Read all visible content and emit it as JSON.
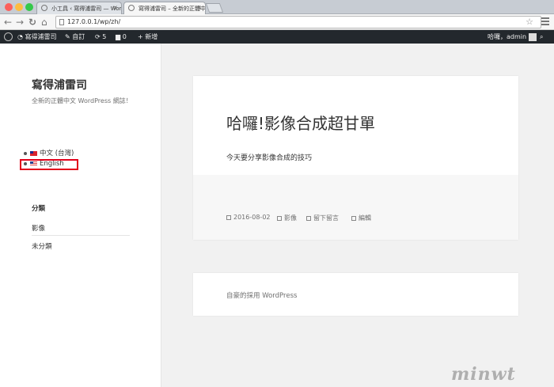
{
  "browser": {
    "tabs": [
      {
        "title": "小工具 ‹ 寫得浦雷司 — Word…",
        "active": false
      },
      {
        "title": "寫得浦雷司 – 全新的正體中文…",
        "active": true
      }
    ],
    "url": "127.0.0.1/wp/zh/",
    "back_icon": "back-arrow-icon",
    "forward_icon": "forward-arrow-icon",
    "reload_icon": "reload-icon",
    "home_icon": "home-icon"
  },
  "adminbar": {
    "site_name": "寫得浦雷司",
    "customize": "自訂",
    "updates_count": "5",
    "comments_count": "0",
    "new_label": "新增",
    "greeting": "哈囉，admin"
  },
  "sidebar": {
    "site_title": "寫得浦雷司",
    "site_description": "全新的正體中文 WordPress 網誌！",
    "languages": [
      {
        "label": "中文 (台灣)",
        "flag": "tw-flag-icon"
      },
      {
        "label": "English",
        "flag": "us-flag-icon"
      }
    ],
    "widget_title": "分類",
    "categories": [
      "影像",
      "未分類"
    ]
  },
  "post": {
    "title": "哈囉!影像合成超甘單",
    "body": "今天要分享影像合成的技巧",
    "date": "2016-08-02",
    "category": "影像",
    "comment_link": "留下留言",
    "edit_link": "編輯"
  },
  "footer": {
    "powered_by": "自豪的採用 WordPress"
  },
  "watermark": "minwt"
}
